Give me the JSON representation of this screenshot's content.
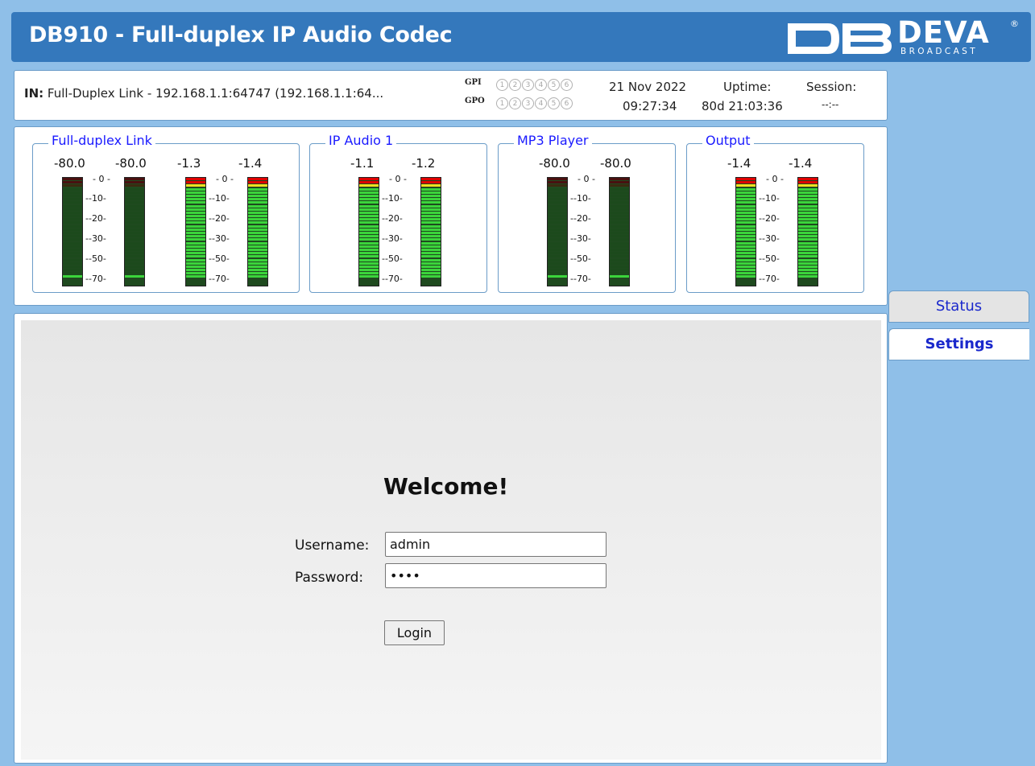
{
  "header": {
    "title": "DB910 - Full-duplex IP Audio Codec"
  },
  "logo": {
    "brand": "DEVA",
    "sub": "BROADCAST",
    "reg": "®"
  },
  "info": {
    "in_label": "IN:",
    "in_value": "Full-Duplex Link - 192.168.1.1:64747 (192.168.1.1:64...",
    "gpi_label": "GPI",
    "gpo_label": "GPO",
    "gp_numbers": [
      "1",
      "2",
      "3",
      "4",
      "5",
      "6"
    ],
    "date": "21 Nov 2022",
    "time": "09:27:34",
    "uptime_label": "Uptime:",
    "uptime_value": "80d 21:03:36",
    "session_label": "Session:",
    "session_value": "--:--"
  },
  "meter_groups": [
    {
      "title": "Full-duplex Link",
      "values": [
        "-80.0",
        "-80.0",
        "-1.3",
        "-1.4"
      ],
      "levels": [
        0,
        0,
        1,
        1
      ]
    },
    {
      "title": "IP Audio 1",
      "values": [
        "-1.1",
        "-1.2"
      ],
      "levels": [
        1,
        1
      ]
    },
    {
      "title": "MP3 Player",
      "values": [
        "-80.0",
        "-80.0"
      ],
      "levels": [
        0,
        0
      ]
    },
    {
      "title": "Output",
      "values": [
        "-1.4",
        "-1.4"
      ],
      "levels": [
        1,
        1
      ]
    }
  ],
  "scale": [
    "0",
    "-10",
    "-20",
    "-30",
    "-50",
    "-70"
  ],
  "tabs": {
    "status": "Status",
    "settings": "Settings"
  },
  "login": {
    "welcome": "Welcome!",
    "username_label": "Username:",
    "password_label": "Password:",
    "username_value": "admin",
    "password_value": "••••",
    "login_button": "Login"
  },
  "colors": {
    "header": "#3478bc",
    "page": "#8fbfe8",
    "legend": "#1a1aff",
    "tab_text": "#1a28cc"
  }
}
